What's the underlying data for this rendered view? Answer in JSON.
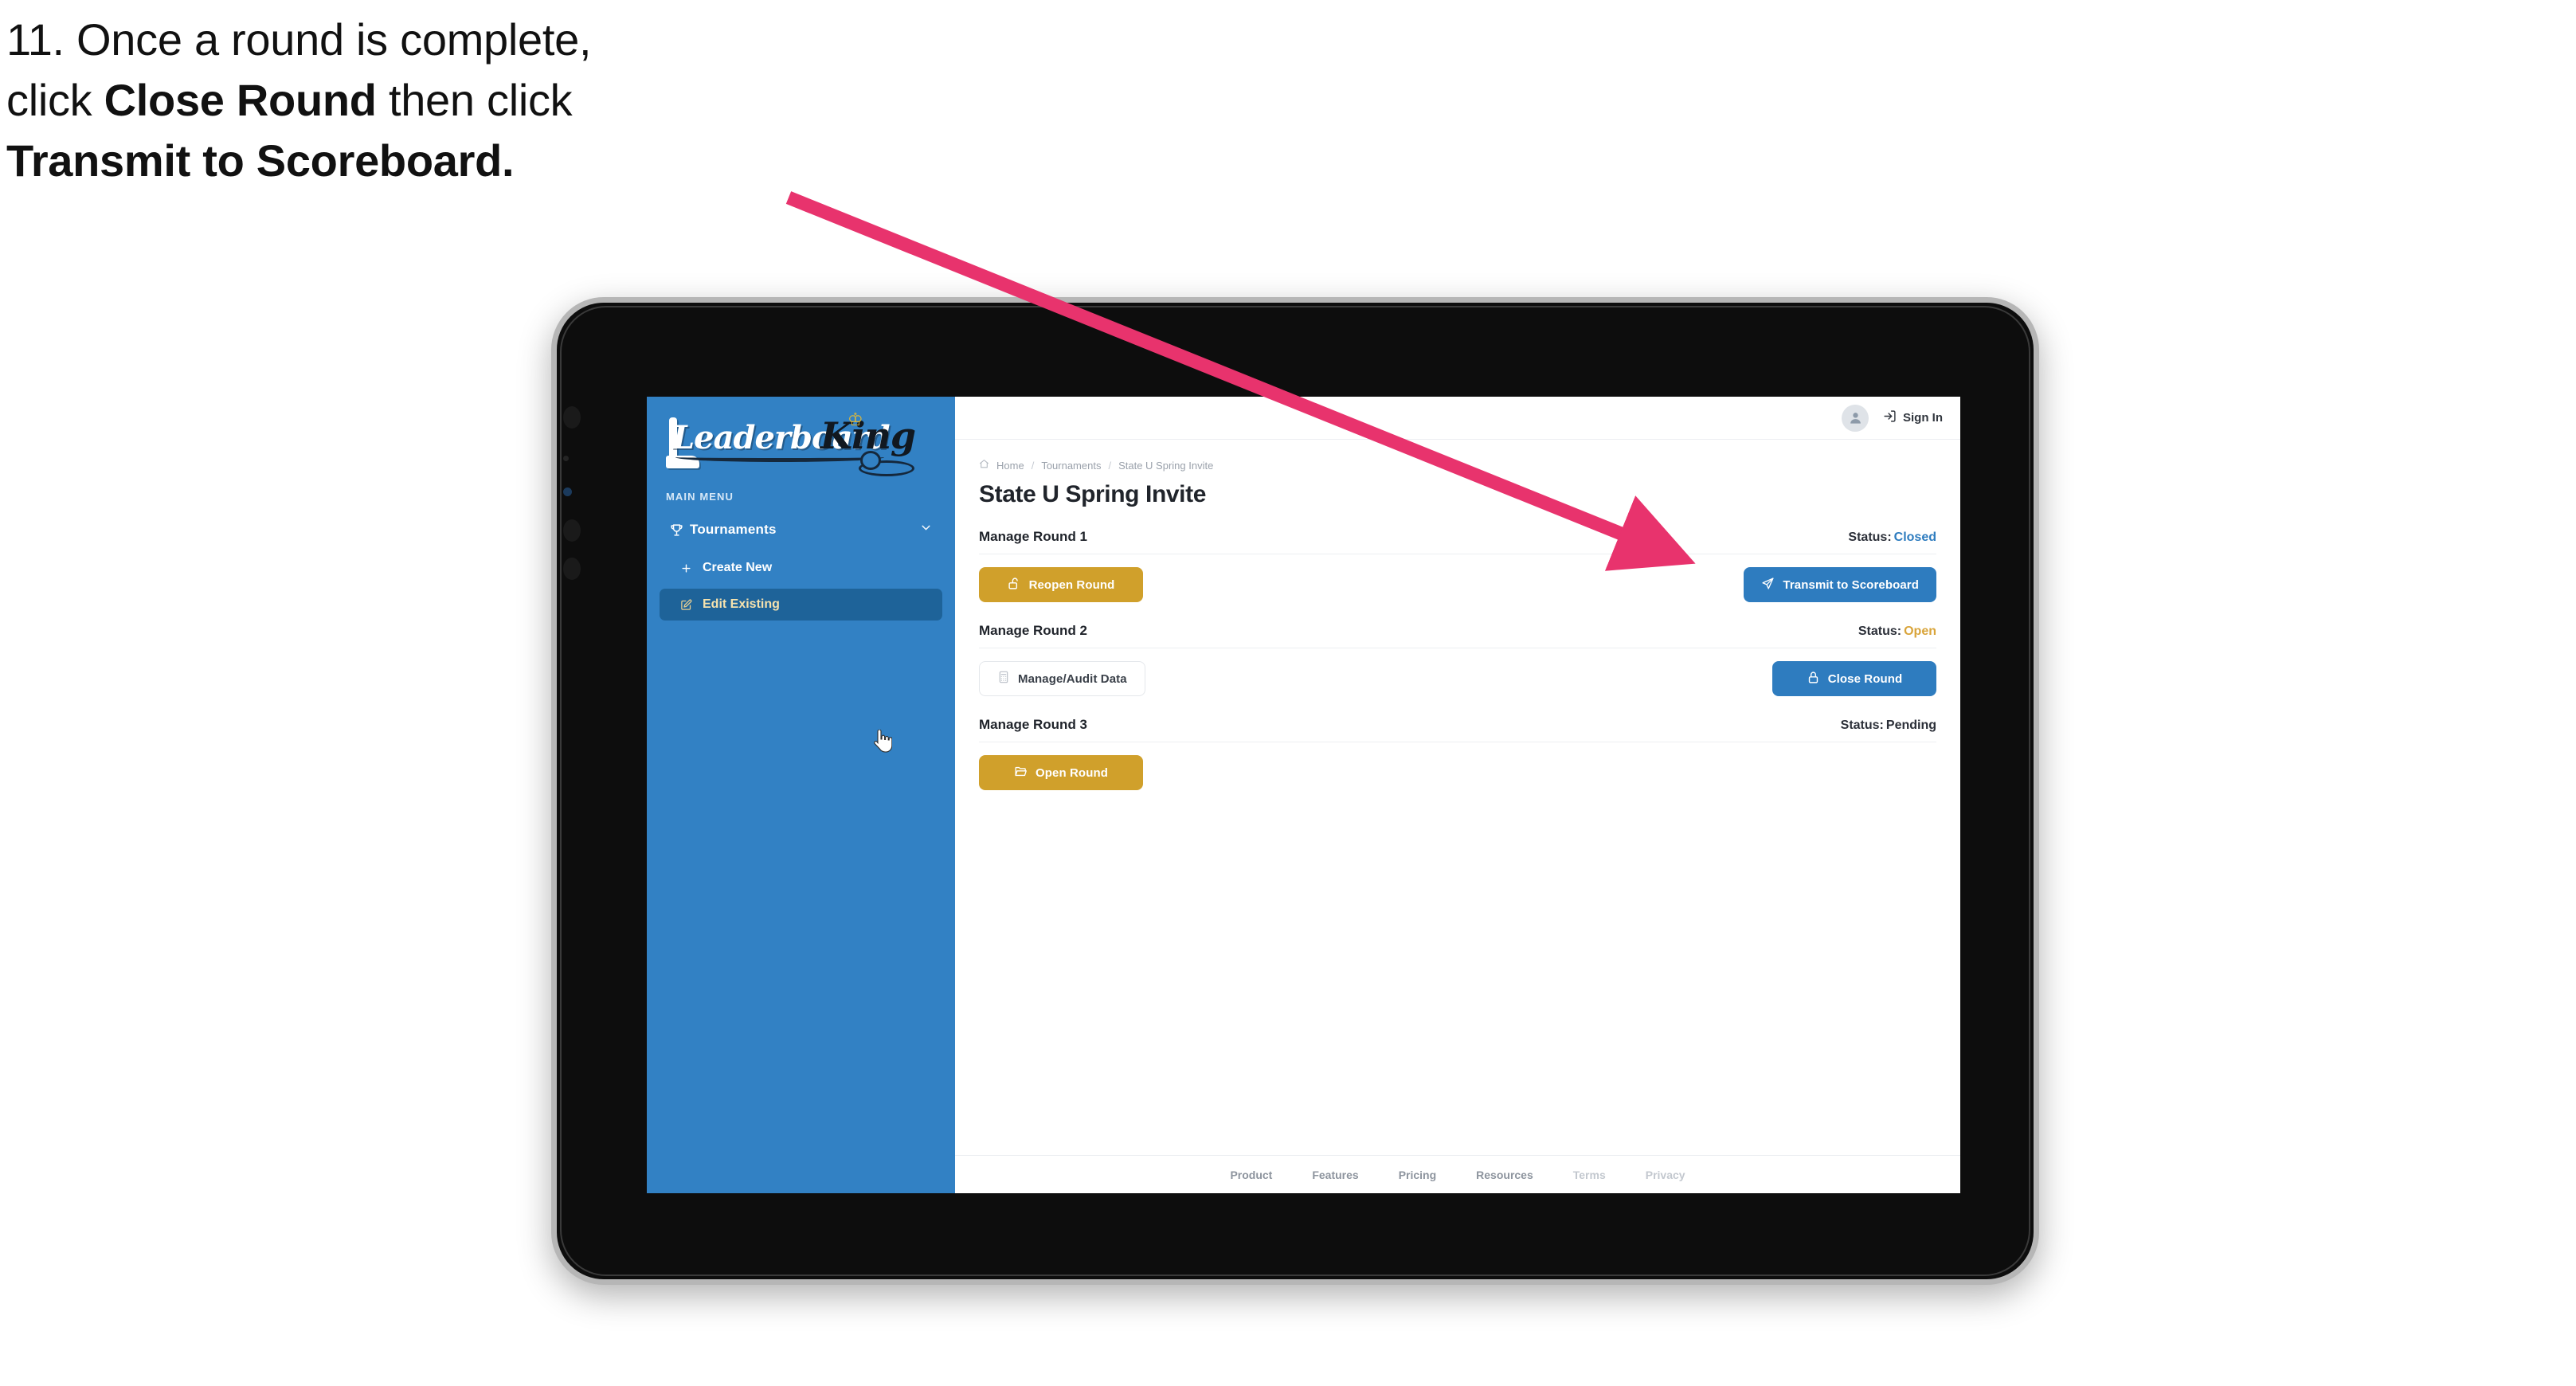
{
  "caption": {
    "line1": "11. Once a round is complete,",
    "line2_pre": "click ",
    "line2_bold": "Close Round",
    "line2_post": " then click",
    "line3_bold": "Transmit to Scoreboard."
  },
  "app": {
    "logo_word": "Leaderboard",
    "logo_king": "King"
  },
  "sidebar": {
    "section_label": "MAIN MENU",
    "nav": {
      "tournaments": "Tournaments"
    },
    "items": [
      {
        "label": "Create New",
        "icon": "plus-icon",
        "active": false
      },
      {
        "label": "Edit Existing",
        "icon": "edit-square-icon",
        "active": true
      }
    ]
  },
  "topbar": {
    "signin_label": "Sign In"
  },
  "breadcrumb": {
    "home": "Home",
    "tournaments": "Tournaments",
    "current": "State U Spring Invite",
    "separator": "/"
  },
  "page": {
    "title": "State U Spring Invite"
  },
  "rounds": [
    {
      "name": "Manage Round 1",
      "status_label": "Status:",
      "status_value": "Closed",
      "status_kind": "closed",
      "left_button": {
        "label": "Reopen Round",
        "style": "gold",
        "icon": "unlock-icon"
      },
      "right_button": {
        "label": "Transmit to Scoreboard",
        "style": "blue",
        "icon": "send-icon"
      }
    },
    {
      "name": "Manage Round 2",
      "status_label": "Status:",
      "status_value": "Open",
      "status_kind": "open",
      "left_button": {
        "label": "Manage/Audit Data",
        "style": "ghost",
        "icon": "calculator-icon"
      },
      "right_button": {
        "label": "Close Round",
        "style": "blue",
        "icon": "lock-icon"
      }
    },
    {
      "name": "Manage Round 3",
      "status_label": "Status:",
      "status_value": "Pending",
      "status_kind": "pending",
      "left_button": {
        "label": "Open Round",
        "style": "gold",
        "icon": "folder-open-icon"
      },
      "right_button": null
    }
  ],
  "footer": {
    "links": [
      {
        "label": "Product",
        "dim": false
      },
      {
        "label": "Features",
        "dim": false
      },
      {
        "label": "Pricing",
        "dim": false
      },
      {
        "label": "Resources",
        "dim": false
      },
      {
        "label": "Terms",
        "dim": true
      },
      {
        "label": "Privacy",
        "dim": true
      }
    ]
  },
  "colors": {
    "sidebar_blue": "#3281c4",
    "sidebar_active": "#1e6399",
    "accent_blue": "#2e7cbf",
    "accent_gold": "#d0a02b",
    "status_open": "#d9a43a",
    "arrow_pink": "#e8336d"
  }
}
